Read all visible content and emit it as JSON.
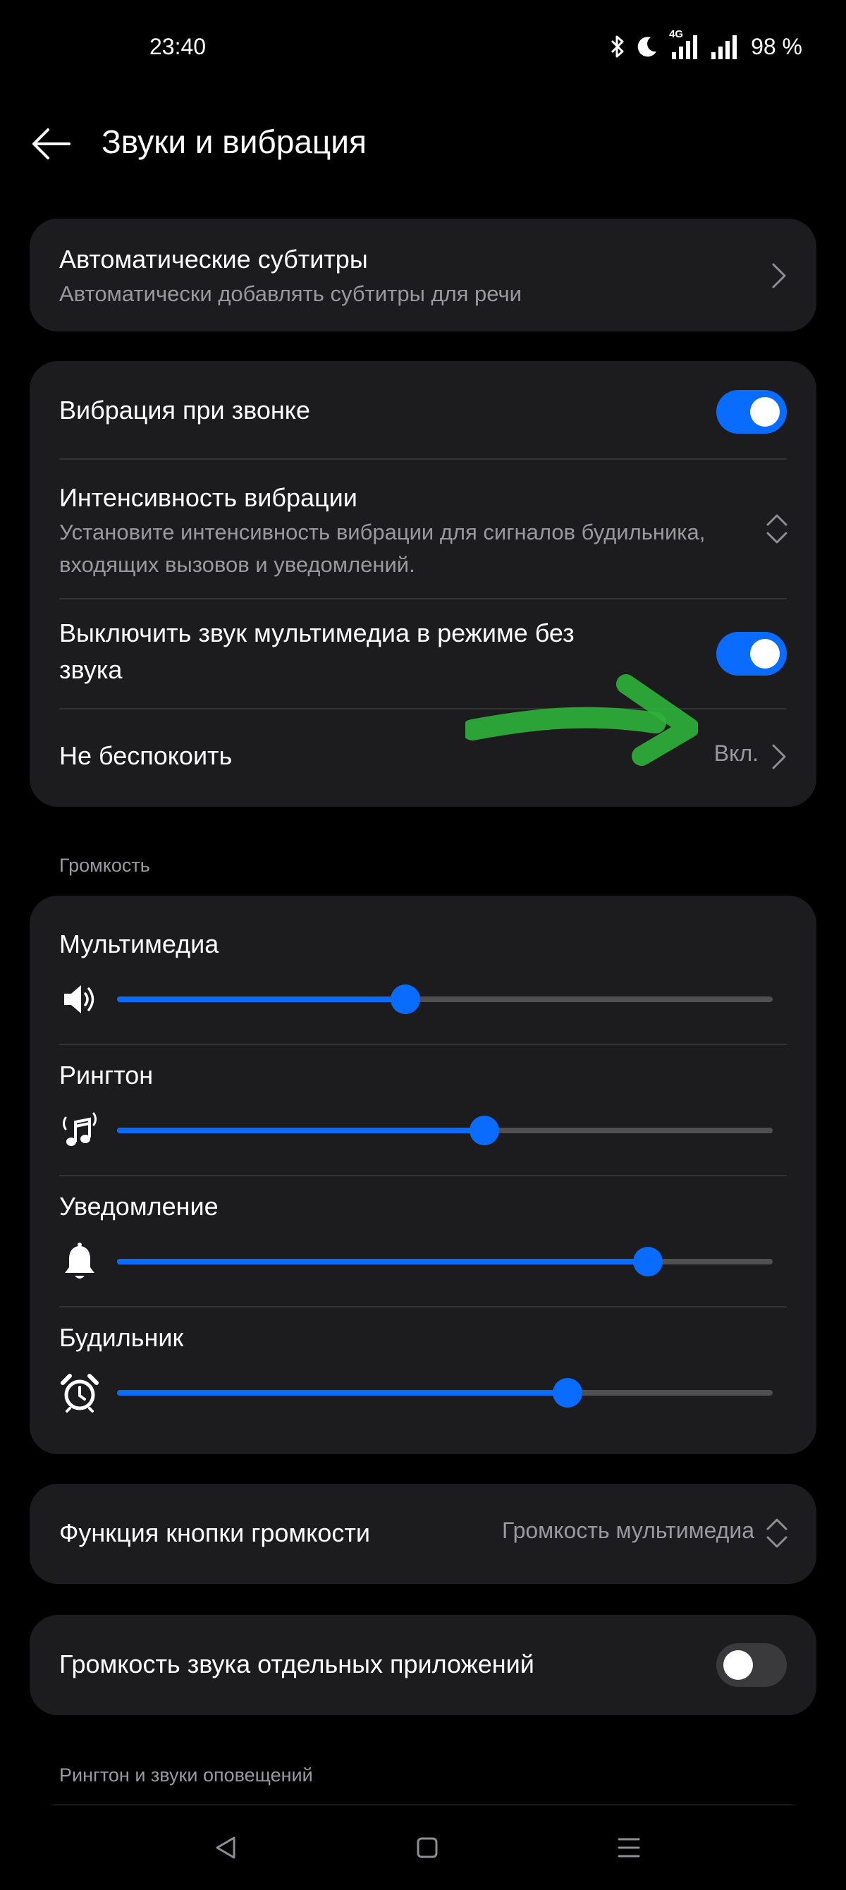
{
  "status_bar": {
    "time": "23:40",
    "network_label": "4G",
    "battery": "98 %",
    "icons": [
      "bluetooth-icon",
      "moon-icon",
      "signal-4g-icon",
      "signal-icon"
    ]
  },
  "header": {
    "title": "Звуки и вибрация",
    "back_icon": "arrow-left-icon"
  },
  "auto_subtitles": {
    "title": "Автоматические субтитры",
    "subtitle": "Автоматически добавлять субтитры для речи"
  },
  "vibration_card": {
    "vibrate_on_call": {
      "title": "Вибрация при звонке",
      "on": true
    },
    "vibration_intensity": {
      "title": "Интенсивность вибрации",
      "subtitle_line1": "Установите интенсивность вибрации для сигналов будильника,",
      "subtitle_line2": "входящих вызовов и уведомлений."
    },
    "mute_media_silent": {
      "title_line1": "Выключить звук мультимедиа в режиме без",
      "title_line2": "звука",
      "on": true
    },
    "do_not_disturb": {
      "title": "Не беспокоить",
      "value": "Вкл."
    }
  },
  "volume_section": {
    "label": "Громкость",
    "sliders": [
      {
        "label": "Мультимедиа",
        "icon": "speaker-icon",
        "level": 0.44
      },
      {
        "label": "Рингтон",
        "icon": "ringtone-music-icon",
        "level": 0.56
      },
      {
        "label": "Уведомление",
        "icon": "bell-icon",
        "level": 0.81
      },
      {
        "label": "Будильник",
        "icon": "alarm-clock-icon",
        "level": 0.687
      }
    ]
  },
  "volume_button": {
    "title": "Функция кнопки громкости",
    "value": "Громкость мультимедиа"
  },
  "app_volume": {
    "title": "Громкость звука отдельных приложений",
    "on": false
  },
  "ringtone_section": {
    "label": "Рингтон и звуки оповещений"
  },
  "colors": {
    "accent": "#0a6cff",
    "card": "#1c1c1e",
    "background": "#000000",
    "annotation": "#2fb33a"
  },
  "nav_bar": {
    "icons": [
      "back-triangle-icon",
      "home-square-icon",
      "menu-lines-icon"
    ]
  }
}
